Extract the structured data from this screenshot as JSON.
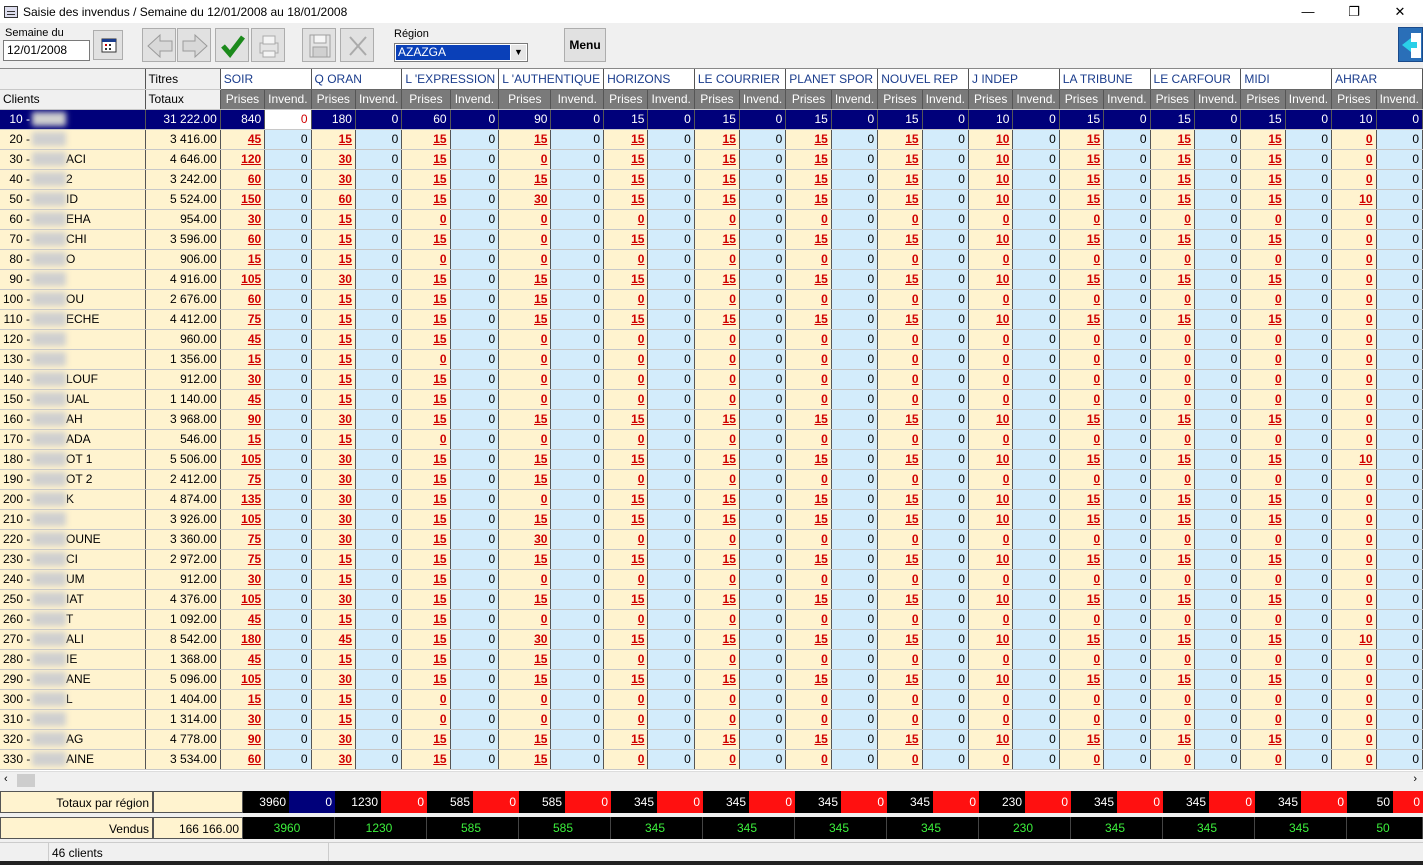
{
  "window": {
    "title": "Saisie des invendus  / Semaine du 12/01/2008 au 18/01/2008",
    "minimize": "—",
    "restore": "❐",
    "close": "✕"
  },
  "toolbar": {
    "week_label": "Semaine du",
    "week_value": "12/01/2008",
    "region_label": "Région",
    "region_value": "AZAZGA",
    "menu_label": "Menu",
    "icons": [
      "calendar-icon",
      "prev-arrow-icon",
      "next-arrow-icon",
      "validate-check-icon",
      "print-icon",
      "save-disk-icon",
      "cut-scissors-icon",
      "exit-door-icon"
    ]
  },
  "grid": {
    "titles_label": "Titres",
    "clients_label": "Clients",
    "totals_label": "Totaux",
    "prises_label": "Prises",
    "invend_label": "Invend.",
    "titles": [
      "SOIR",
      "Q ORAN",
      "L 'EXPRESSION",
      "L 'AUTHENTIQUE",
      "HORIZONS",
      "LE COURRIER",
      "PLANET SPOR",
      "NOUVEL REP",
      "J INDEP",
      "LA TRIBUNE",
      "LE CARFOUR",
      "MIDI",
      "AHRAR"
    ],
    "selected_row": 0,
    "rows": [
      {
        "code": "10 -",
        "suffix": "",
        "total": "31 222.00",
        "prises": [
          "840",
          "180",
          "60",
          "90",
          "15",
          "15",
          "15",
          "15",
          "10",
          "15",
          "15",
          "15",
          "10"
        ]
      },
      {
        "code": "20 -",
        "suffix": "",
        "total": "3 416.00",
        "prises": [
          "45",
          "15",
          "15",
          "15",
          "15",
          "15",
          "15",
          "15",
          "10",
          "15",
          "15",
          "15",
          "0"
        ]
      },
      {
        "code": "30 -",
        "suffix": "ACI",
        "total": "4 646.00",
        "prises": [
          "120",
          "30",
          "15",
          "0",
          "15",
          "15",
          "15",
          "15",
          "10",
          "15",
          "15",
          "15",
          "0"
        ]
      },
      {
        "code": "40 -",
        "suffix": "2",
        "total": "3 242.00",
        "prises": [
          "60",
          "30",
          "15",
          "15",
          "15",
          "15",
          "15",
          "15",
          "10",
          "15",
          "15",
          "15",
          "0"
        ]
      },
      {
        "code": "50 -",
        "suffix": "ID",
        "total": "5 524.00",
        "prises": [
          "150",
          "60",
          "15",
          "30",
          "15",
          "15",
          "15",
          "15",
          "10",
          "15",
          "15",
          "15",
          "10"
        ]
      },
      {
        "code": "60 -",
        "suffix": "EHA",
        "total": "954.00",
        "prises": [
          "30",
          "15",
          "0",
          "0",
          "0",
          "0",
          "0",
          "0",
          "0",
          "0",
          "0",
          "0",
          "0"
        ]
      },
      {
        "code": "70 -",
        "suffix": "CHI",
        "total": "3 596.00",
        "prises": [
          "60",
          "15",
          "15",
          "0",
          "15",
          "15",
          "15",
          "15",
          "10",
          "15",
          "15",
          "15",
          "0"
        ]
      },
      {
        "code": "80 -",
        "suffix": "O",
        "total": "906.00",
        "prises": [
          "15",
          "15",
          "0",
          "0",
          "0",
          "0",
          "0",
          "0",
          "0",
          "0",
          "0",
          "0",
          "0"
        ]
      },
      {
        "code": "90 -",
        "suffix": "",
        "total": "4 916.00",
        "prises": [
          "105",
          "30",
          "15",
          "15",
          "15",
          "15",
          "15",
          "15",
          "10",
          "15",
          "15",
          "15",
          "0"
        ]
      },
      {
        "code": "100 -",
        "suffix": "OU",
        "total": "2 676.00",
        "prises": [
          "60",
          "15",
          "15",
          "15",
          "0",
          "0",
          "0",
          "0",
          "0",
          "0",
          "0",
          "0",
          "0"
        ]
      },
      {
        "code": "110 -",
        "suffix": "ECHE",
        "total": "4 412.00",
        "prises": [
          "75",
          "15",
          "15",
          "15",
          "15",
          "15",
          "15",
          "15",
          "10",
          "15",
          "15",
          "15",
          "0"
        ]
      },
      {
        "code": "120 -",
        "suffix": "",
        "total": "960.00",
        "prises": [
          "45",
          "15",
          "15",
          "0",
          "0",
          "0",
          "0",
          "0",
          "0",
          "0",
          "0",
          "0",
          "0"
        ]
      },
      {
        "code": "130 -",
        "suffix": "",
        "total": "1 356.00",
        "prises": [
          "15",
          "15",
          "0",
          "0",
          "0",
          "0",
          "0",
          "0",
          "0",
          "0",
          "0",
          "0",
          "0"
        ]
      },
      {
        "code": "140 -",
        "suffix": "LOUF",
        "total": "912.00",
        "prises": [
          "30",
          "15",
          "15",
          "0",
          "0",
          "0",
          "0",
          "0",
          "0",
          "0",
          "0",
          "0",
          "0"
        ]
      },
      {
        "code": "150 -",
        "suffix": "UAL",
        "total": "1 140.00",
        "prises": [
          "45",
          "15",
          "15",
          "0",
          "0",
          "0",
          "0",
          "0",
          "0",
          "0",
          "0",
          "0",
          "0"
        ]
      },
      {
        "code": "160 -",
        "suffix": "AH",
        "total": "3 968.00",
        "prises": [
          "90",
          "30",
          "15",
          "15",
          "15",
          "15",
          "15",
          "15",
          "10",
          "15",
          "15",
          "15",
          "0"
        ]
      },
      {
        "code": "170 -",
        "suffix": "ADA",
        "total": "546.00",
        "prises": [
          "15",
          "15",
          "0",
          "0",
          "0",
          "0",
          "0",
          "0",
          "0",
          "0",
          "0",
          "0",
          "0"
        ]
      },
      {
        "code": "180 -",
        "suffix": "OT 1",
        "total": "5 506.00",
        "prises": [
          "105",
          "30",
          "15",
          "15",
          "15",
          "15",
          "15",
          "15",
          "10",
          "15",
          "15",
          "15",
          "10"
        ]
      },
      {
        "code": "190 -",
        "suffix": "OT 2",
        "total": "2 412.00",
        "prises": [
          "75",
          "30",
          "15",
          "15",
          "0",
          "0",
          "0",
          "0",
          "0",
          "0",
          "0",
          "0",
          "0"
        ]
      },
      {
        "code": "200 -",
        "suffix": "K",
        "total": "4 874.00",
        "prises": [
          "135",
          "30",
          "15",
          "0",
          "15",
          "15",
          "15",
          "15",
          "10",
          "15",
          "15",
          "15",
          "0"
        ]
      },
      {
        "code": "210 -",
        "suffix": "",
        "total": "3 926.00",
        "prises": [
          "105",
          "30",
          "15",
          "15",
          "15",
          "15",
          "15",
          "15",
          "10",
          "15",
          "15",
          "15",
          "0"
        ]
      },
      {
        "code": "220 -",
        "suffix": "OUNE",
        "total": "3 360.00",
        "prises": [
          "75",
          "30",
          "15",
          "30",
          "0",
          "0",
          "0",
          "0",
          "0",
          "0",
          "0",
          "0",
          "0"
        ]
      },
      {
        "code": "230 -",
        "suffix": "CI",
        "total": "2 972.00",
        "prises": [
          "75",
          "15",
          "15",
          "15",
          "15",
          "15",
          "15",
          "15",
          "10",
          "15",
          "15",
          "15",
          "0"
        ]
      },
      {
        "code": "240 -",
        "suffix": "UM",
        "total": "912.00",
        "prises": [
          "30",
          "15",
          "15",
          "0",
          "0",
          "0",
          "0",
          "0",
          "0",
          "0",
          "0",
          "0",
          "0"
        ]
      },
      {
        "code": "250 -",
        "suffix": "IAT",
        "total": "4 376.00",
        "prises": [
          "105",
          "30",
          "15",
          "15",
          "15",
          "15",
          "15",
          "15",
          "10",
          "15",
          "15",
          "15",
          "0"
        ]
      },
      {
        "code": "260 -",
        "suffix": "T",
        "total": "1 092.00",
        "prises": [
          "45",
          "15",
          "15",
          "0",
          "0",
          "0",
          "0",
          "0",
          "0",
          "0",
          "0",
          "0",
          "0"
        ]
      },
      {
        "code": "270 -",
        "suffix": "ALI",
        "total": "8 542.00",
        "prises": [
          "180",
          "45",
          "15",
          "30",
          "15",
          "15",
          "15",
          "15",
          "10",
          "15",
          "15",
          "15",
          "10"
        ]
      },
      {
        "code": "280 -",
        "suffix": "IE",
        "total": "1 368.00",
        "prises": [
          "45",
          "15",
          "15",
          "15",
          "0",
          "0",
          "0",
          "0",
          "0",
          "0",
          "0",
          "0",
          "0"
        ]
      },
      {
        "code": "290 -",
        "suffix": "ANE",
        "total": "5 096.00",
        "prises": [
          "105",
          "30",
          "15",
          "15",
          "15",
          "15",
          "15",
          "15",
          "10",
          "15",
          "15",
          "15",
          "0"
        ]
      },
      {
        "code": "300 -",
        "suffix": "L",
        "total": "1 404.00",
        "prises": [
          "15",
          "15",
          "0",
          "0",
          "0",
          "0",
          "0",
          "0",
          "0",
          "0",
          "0",
          "0",
          "0"
        ]
      },
      {
        "code": "310 -",
        "suffix": "",
        "total": "1 314.00",
        "prises": [
          "30",
          "15",
          "0",
          "0",
          "0",
          "0",
          "0",
          "0",
          "0",
          "0",
          "0",
          "0",
          "0"
        ]
      },
      {
        "code": "320 -",
        "suffix": "AG",
        "total": "4 778.00",
        "prises": [
          "90",
          "30",
          "15",
          "15",
          "15",
          "15",
          "15",
          "15",
          "10",
          "15",
          "15",
          "15",
          "0"
        ]
      },
      {
        "code": "330 -",
        "suffix": "AINE",
        "total": "3 534.00",
        "prises": [
          "60",
          "30",
          "15",
          "15",
          "0",
          "0",
          "0",
          "0",
          "0",
          "0",
          "0",
          "0",
          "0"
        ]
      }
    ]
  },
  "totals": {
    "region_label": "Totaux par région",
    "vendus_label": "Vendus",
    "vendus_total": "166 166.00",
    "region_prises": [
      "3960",
      "1230",
      "585",
      "585",
      "345",
      "345",
      "345",
      "345",
      "230",
      "345",
      "345",
      "345",
      "50"
    ],
    "vendus": [
      "3960",
      "1230",
      "585",
      "585",
      "345",
      "345",
      "345",
      "345",
      "230",
      "345",
      "345",
      "345",
      "50"
    ]
  },
  "status": {
    "clients_count": "46 clients"
  },
  "colors": {
    "client_bg": "#fff3cf",
    "invend_bg": "#d3ecfb",
    "selected_bg": "#00007a",
    "prises_text": "#d00000",
    "vendus_text": "#3cf03c"
  }
}
